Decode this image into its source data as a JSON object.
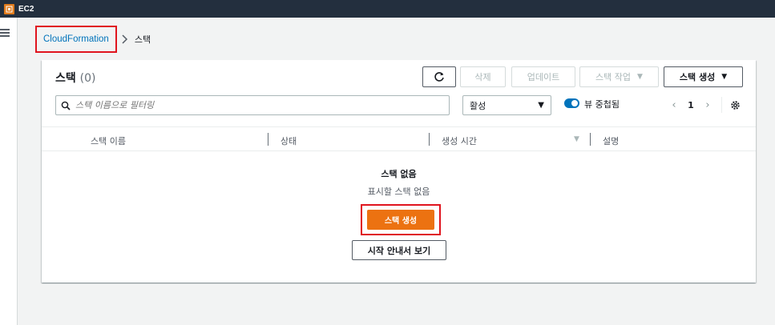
{
  "topbar": {
    "service_name": "EC2"
  },
  "breadcrumb": {
    "root": "CloudFormation",
    "current": "스택"
  },
  "panel": {
    "title": "스택",
    "count": "(0)",
    "buttons": {
      "delete": "삭제",
      "update": "업데이트",
      "actions": "스택 작업",
      "create": "스택 생성"
    },
    "search": {
      "placeholder": "스택 이름으로 필터링"
    },
    "filter": {
      "selected": "활성"
    },
    "toggle": {
      "label": "뷰 중첩됨",
      "on": true
    },
    "pager": {
      "page": "1"
    }
  },
  "table": {
    "columns": [
      "스택 이름",
      "상태",
      "생성 시간",
      "설명"
    ]
  },
  "empty": {
    "title": "스택 없음",
    "subtitle": "표시할 스택 없음",
    "create_button": "스택 생성",
    "guide_button": "시작 안내서 보기"
  },
  "colors": {
    "accent": "#ec7211",
    "link": "#0073bb",
    "topbar": "#232f3e",
    "highlight": "#e0141e"
  },
  "icons": [
    "cloudformation-icon",
    "hamburger-icon",
    "chevron-right-icon",
    "refresh-icon",
    "caret-down-icon",
    "search-icon",
    "chevron-left-icon",
    "gear-icon",
    "sort-down-icon"
  ]
}
